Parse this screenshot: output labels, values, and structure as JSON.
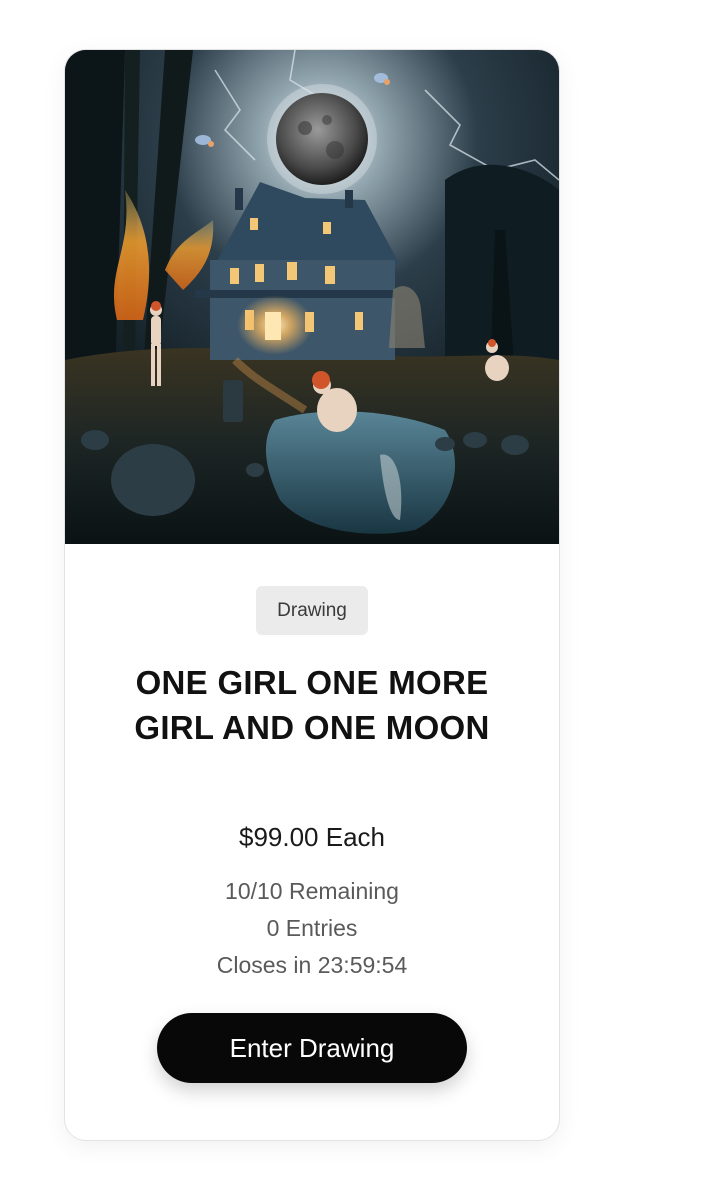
{
  "card": {
    "category": "Drawing",
    "title": "ONE GIRL ONE MORE GIRL AND ONE MOON",
    "price": "$99.00 Each",
    "remaining": "10/10 Remaining",
    "entries": "0 Entries",
    "closes": "Closes in 23:59:54",
    "button_label": "Enter Drawing"
  },
  "colors": {
    "button_bg": "#080808",
    "badge_bg": "#ebebeb",
    "stat_text": "#5a5a5a"
  }
}
